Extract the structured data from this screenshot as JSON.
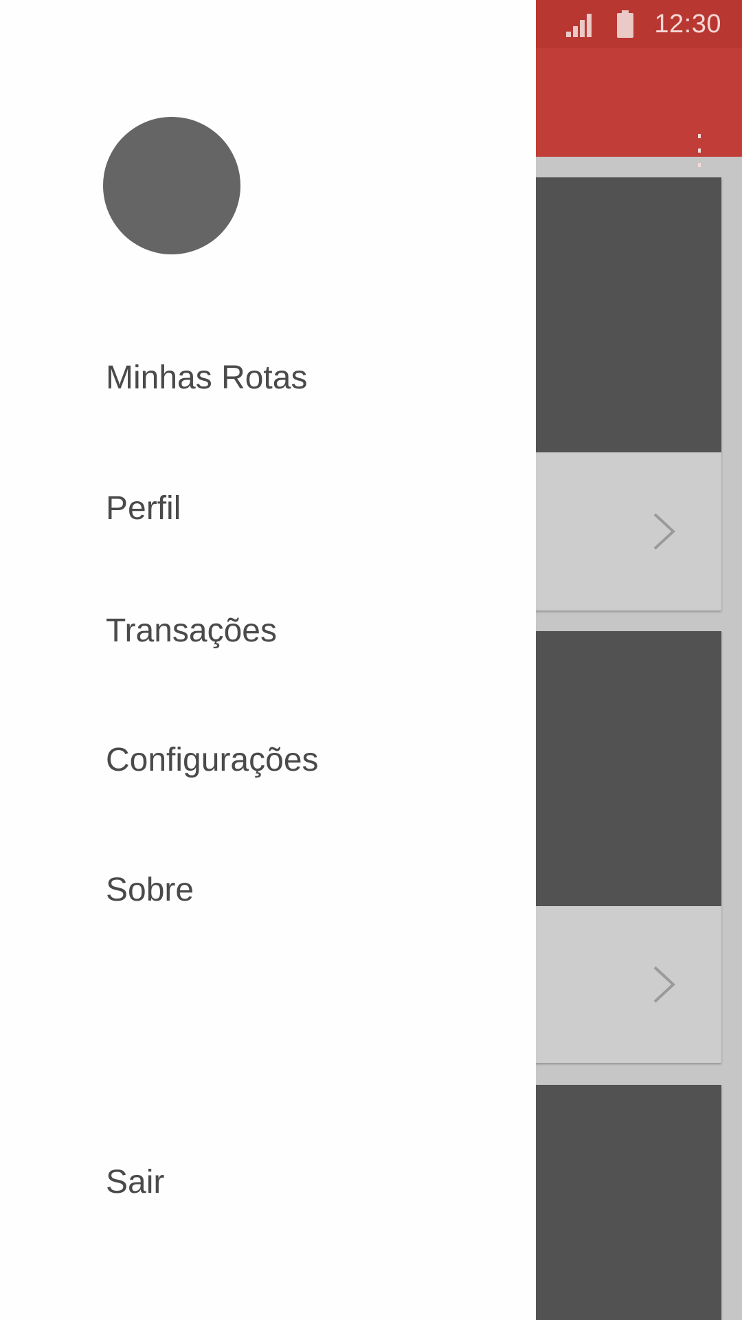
{
  "status_bar": {
    "time": "12:30",
    "signal_icon": "signal-icon",
    "battery_icon": "battery-icon"
  },
  "app_bar": {
    "overflow_icon": "more-vert-icon"
  },
  "drawer": {
    "avatar": "avatar",
    "items": [
      {
        "label": "Minhas Rotas"
      },
      {
        "label": "Perfil"
      },
      {
        "label": "Transações"
      },
      {
        "label": "Configurações"
      },
      {
        "label": "Sobre"
      }
    ],
    "logout_label": "Sair"
  },
  "cards": [
    {
      "chevron_icon": "chevron-right-icon"
    },
    {
      "chevron_icon": "chevron-right-icon"
    },
    {
      "chevron_icon": "none"
    }
  ],
  "colors": {
    "accent": "#c13e38",
    "status_bar": "#b83731",
    "drawer_text": "#4a4a4a",
    "card_image": "#525252",
    "card_footer": "#cdcdcd"
  }
}
